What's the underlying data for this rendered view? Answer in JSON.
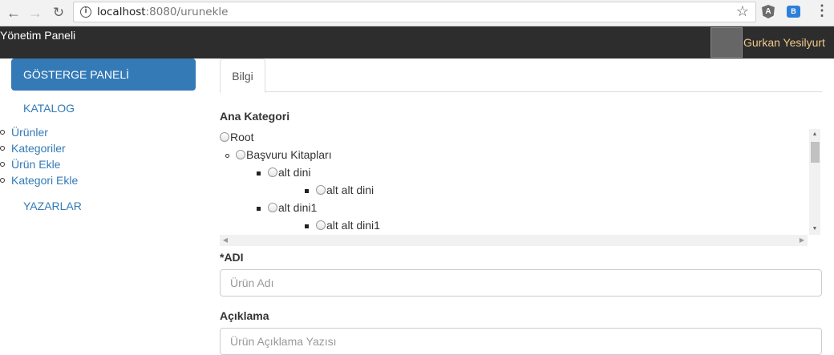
{
  "browser": {
    "url_host": "localhost",
    "url_rest": ":8080/urunekle",
    "info_glyph": "i",
    "ext_badge": "A",
    "ext_badge2": "B"
  },
  "navbar": {
    "brand": "Yönetim Paneli",
    "user_name": "Gurkan Yesilyurt"
  },
  "sidebar": {
    "dashboard_label": "GÖSTERGE PANELİ",
    "catalog_label": "KATALOG",
    "items": [
      {
        "label": "Ürünler"
      },
      {
        "label": "Kategoriler"
      },
      {
        "label": "Ürün Ekle"
      },
      {
        "label": "Kategori Ekle"
      }
    ],
    "authors_label": "YAZARLAR"
  },
  "main": {
    "tab_label": "Bilgi",
    "category_label": "Ana Kategori",
    "tree": [
      {
        "label": "Root"
      },
      {
        "label": "Başvuru Kitapları"
      },
      {
        "label": "alt dini"
      },
      {
        "label": "alt alt dini"
      },
      {
        "label": "alt dini1"
      },
      {
        "label": "alt alt dini1"
      }
    ],
    "name_label": "*ADI",
    "name_placeholder": "Ürün Adı",
    "desc_label": "Açıklama",
    "desc_placeholder": "Ürün Açıklama Yazısı"
  },
  "colors": {
    "navbar_bg": "#2d2d2d",
    "primary": "#337ab7",
    "user_name": "#f0c98a"
  }
}
